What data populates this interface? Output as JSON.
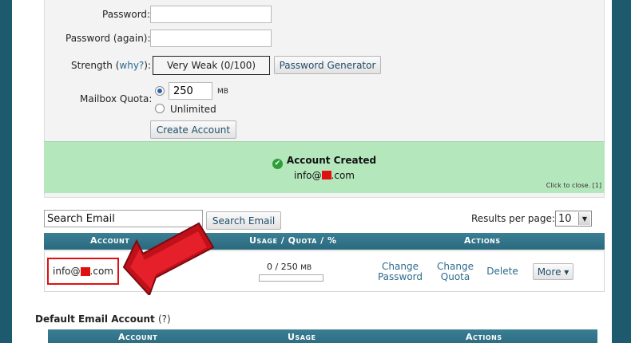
{
  "form": {
    "password_label": "Password:",
    "password_again_label": "Password (again):",
    "strength_label": "Strength (",
    "strength_why": "why?",
    "strength_label_end": "):",
    "strength_value": "Very Weak (0/100)",
    "password_generator_button": "Password Generator",
    "quota_label": "Mailbox Quota:",
    "quota_value": "250",
    "quota_unit": "MB",
    "unlimited_label": "Unlimited",
    "create_button": "Create Account"
  },
  "notice": {
    "title": "Account Created",
    "email_prefix": "info@",
    "email_suffix": ".com",
    "close_text": "Click to close. [1]"
  },
  "search": {
    "input_value": "Search Email",
    "button": "Search Email",
    "results_label": "Results per page:",
    "results_value": "10"
  },
  "table": {
    "headers": [
      "Account",
      "Usage / Quota / %",
      "Actions"
    ],
    "row": {
      "email_prefix": "info@",
      "email_suffix": ".com",
      "usage": "0 / 250",
      "usage_unit": "MB",
      "usage_fraction": 0,
      "actions": {
        "change_password_1": "Change",
        "change_password_2": "Password",
        "change_quota_1": "Change",
        "change_quota_2": "Quota",
        "delete": "Delete",
        "more": "More ▾"
      }
    }
  },
  "default_account": {
    "title": "Default Email Account",
    "help": "(?)",
    "headers": [
      "Account",
      "Usage",
      "Actions"
    ]
  },
  "colors": {
    "header_bg": "#2e6f84",
    "success_bg": "#b5e7bc",
    "highlight": "#e01010",
    "link": "#2b6a8e"
  }
}
